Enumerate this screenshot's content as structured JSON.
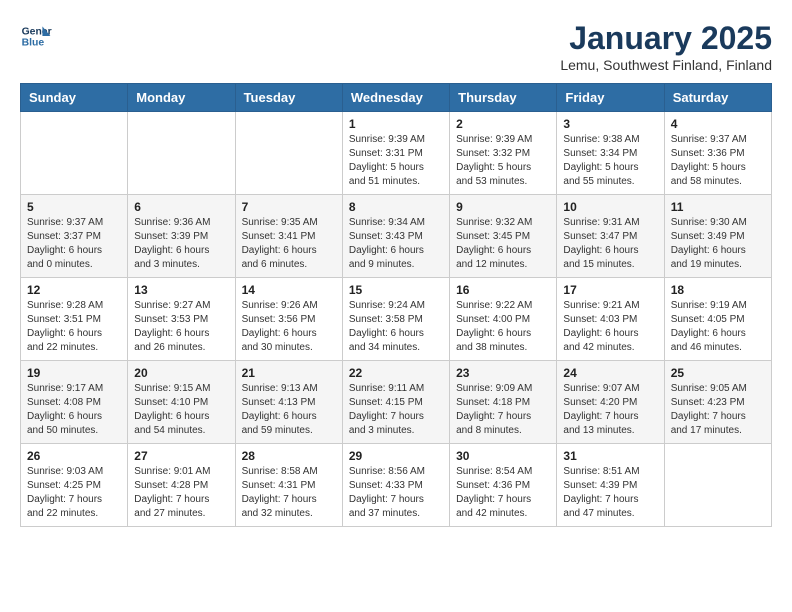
{
  "header": {
    "logo_line1": "General",
    "logo_line2": "Blue",
    "month": "January 2025",
    "location": "Lemu, Southwest Finland, Finland"
  },
  "weekdays": [
    "Sunday",
    "Monday",
    "Tuesday",
    "Wednesday",
    "Thursday",
    "Friday",
    "Saturday"
  ],
  "weeks": [
    [
      {
        "day": "",
        "info": ""
      },
      {
        "day": "",
        "info": ""
      },
      {
        "day": "",
        "info": ""
      },
      {
        "day": "1",
        "info": "Sunrise: 9:39 AM\nSunset: 3:31 PM\nDaylight: 5 hours\nand 51 minutes."
      },
      {
        "day": "2",
        "info": "Sunrise: 9:39 AM\nSunset: 3:32 PM\nDaylight: 5 hours\nand 53 minutes."
      },
      {
        "day": "3",
        "info": "Sunrise: 9:38 AM\nSunset: 3:34 PM\nDaylight: 5 hours\nand 55 minutes."
      },
      {
        "day": "4",
        "info": "Sunrise: 9:37 AM\nSunset: 3:36 PM\nDaylight: 5 hours\nand 58 minutes."
      }
    ],
    [
      {
        "day": "5",
        "info": "Sunrise: 9:37 AM\nSunset: 3:37 PM\nDaylight: 6 hours\nand 0 minutes."
      },
      {
        "day": "6",
        "info": "Sunrise: 9:36 AM\nSunset: 3:39 PM\nDaylight: 6 hours\nand 3 minutes."
      },
      {
        "day": "7",
        "info": "Sunrise: 9:35 AM\nSunset: 3:41 PM\nDaylight: 6 hours\nand 6 minutes."
      },
      {
        "day": "8",
        "info": "Sunrise: 9:34 AM\nSunset: 3:43 PM\nDaylight: 6 hours\nand 9 minutes."
      },
      {
        "day": "9",
        "info": "Sunrise: 9:32 AM\nSunset: 3:45 PM\nDaylight: 6 hours\nand 12 minutes."
      },
      {
        "day": "10",
        "info": "Sunrise: 9:31 AM\nSunset: 3:47 PM\nDaylight: 6 hours\nand 15 minutes."
      },
      {
        "day": "11",
        "info": "Sunrise: 9:30 AM\nSunset: 3:49 PM\nDaylight: 6 hours\nand 19 minutes."
      }
    ],
    [
      {
        "day": "12",
        "info": "Sunrise: 9:28 AM\nSunset: 3:51 PM\nDaylight: 6 hours\nand 22 minutes."
      },
      {
        "day": "13",
        "info": "Sunrise: 9:27 AM\nSunset: 3:53 PM\nDaylight: 6 hours\nand 26 minutes."
      },
      {
        "day": "14",
        "info": "Sunrise: 9:26 AM\nSunset: 3:56 PM\nDaylight: 6 hours\nand 30 minutes."
      },
      {
        "day": "15",
        "info": "Sunrise: 9:24 AM\nSunset: 3:58 PM\nDaylight: 6 hours\nand 34 minutes."
      },
      {
        "day": "16",
        "info": "Sunrise: 9:22 AM\nSunset: 4:00 PM\nDaylight: 6 hours\nand 38 minutes."
      },
      {
        "day": "17",
        "info": "Sunrise: 9:21 AM\nSunset: 4:03 PM\nDaylight: 6 hours\nand 42 minutes."
      },
      {
        "day": "18",
        "info": "Sunrise: 9:19 AM\nSunset: 4:05 PM\nDaylight: 6 hours\nand 46 minutes."
      }
    ],
    [
      {
        "day": "19",
        "info": "Sunrise: 9:17 AM\nSunset: 4:08 PM\nDaylight: 6 hours\nand 50 minutes."
      },
      {
        "day": "20",
        "info": "Sunrise: 9:15 AM\nSunset: 4:10 PM\nDaylight: 6 hours\nand 54 minutes."
      },
      {
        "day": "21",
        "info": "Sunrise: 9:13 AM\nSunset: 4:13 PM\nDaylight: 6 hours\nand 59 minutes."
      },
      {
        "day": "22",
        "info": "Sunrise: 9:11 AM\nSunset: 4:15 PM\nDaylight: 7 hours\nand 3 minutes."
      },
      {
        "day": "23",
        "info": "Sunrise: 9:09 AM\nSunset: 4:18 PM\nDaylight: 7 hours\nand 8 minutes."
      },
      {
        "day": "24",
        "info": "Sunrise: 9:07 AM\nSunset: 4:20 PM\nDaylight: 7 hours\nand 13 minutes."
      },
      {
        "day": "25",
        "info": "Sunrise: 9:05 AM\nSunset: 4:23 PM\nDaylight: 7 hours\nand 17 minutes."
      }
    ],
    [
      {
        "day": "26",
        "info": "Sunrise: 9:03 AM\nSunset: 4:25 PM\nDaylight: 7 hours\nand 22 minutes."
      },
      {
        "day": "27",
        "info": "Sunrise: 9:01 AM\nSunset: 4:28 PM\nDaylight: 7 hours\nand 27 minutes."
      },
      {
        "day": "28",
        "info": "Sunrise: 8:58 AM\nSunset: 4:31 PM\nDaylight: 7 hours\nand 32 minutes."
      },
      {
        "day": "29",
        "info": "Sunrise: 8:56 AM\nSunset: 4:33 PM\nDaylight: 7 hours\nand 37 minutes."
      },
      {
        "day": "30",
        "info": "Sunrise: 8:54 AM\nSunset: 4:36 PM\nDaylight: 7 hours\nand 42 minutes."
      },
      {
        "day": "31",
        "info": "Sunrise: 8:51 AM\nSunset: 4:39 PM\nDaylight: 7 hours\nand 47 minutes."
      },
      {
        "day": "",
        "info": ""
      }
    ]
  ]
}
